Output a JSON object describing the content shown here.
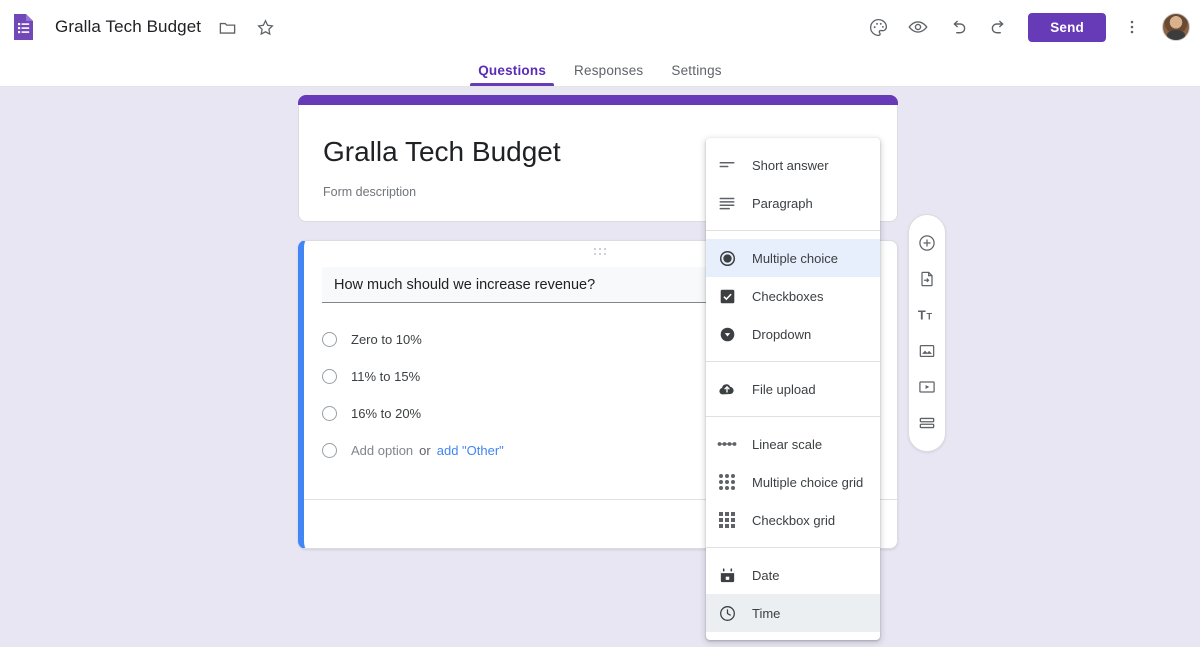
{
  "app": {
    "logo_icon": "google-forms-icon",
    "doc_title": "Gralla Tech Budget",
    "folder_icon": "folder-icon",
    "star_icon": "star-icon"
  },
  "topbar_actions": {
    "theme_icon": "palette-icon",
    "preview_icon": "eye-icon",
    "undo_icon": "undo-icon",
    "redo_icon": "redo-icon",
    "send_label": "Send",
    "more_icon": "more-vert-icon",
    "avatar": "user-avatar"
  },
  "tabs": [
    {
      "label": "Questions",
      "active": true
    },
    {
      "label": "Responses",
      "active": false
    },
    {
      "label": "Settings",
      "active": false
    }
  ],
  "form_header": {
    "title": "Gralla Tech Budget",
    "description_placeholder": "Form description",
    "accent_color": "#673ab7"
  },
  "question": {
    "text": "How much should we increase revenue?",
    "image_icon": "add-image-icon",
    "drag_handle_icon": "drag-handle-icon",
    "duplicate_icon": "duplicate-icon",
    "active_border_color": "#4285f4",
    "options": [
      {
        "label": "Zero to 10%",
        "placeholder": false
      },
      {
        "label": "11% to 15%",
        "placeholder": false
      },
      {
        "label": "16% to 20%",
        "placeholder": false
      }
    ],
    "add_option_label": "Add option",
    "or_label": "or",
    "add_other_label": "add \"Other\""
  },
  "side_toolbar": [
    {
      "name": "add-question-icon",
      "title": "Add question"
    },
    {
      "name": "import-questions-icon",
      "title": "Import questions"
    },
    {
      "name": "add-title-icon",
      "title": "Add title and description"
    },
    {
      "name": "add-image-icon",
      "title": "Add image"
    },
    {
      "name": "add-video-icon",
      "title": "Add video"
    },
    {
      "name": "add-section-icon",
      "title": "Add section"
    }
  ],
  "type_menu": {
    "groups": [
      {
        "items": [
          {
            "label": "Short answer",
            "icon": "short-answer-icon",
            "state": "normal"
          },
          {
            "label": "Paragraph",
            "icon": "paragraph-icon",
            "state": "normal"
          }
        ]
      },
      {
        "items": [
          {
            "label": "Multiple choice",
            "icon": "radio-button-icon",
            "state": "selected"
          },
          {
            "label": "Checkboxes",
            "icon": "checkbox-icon",
            "state": "normal"
          },
          {
            "label": "Dropdown",
            "icon": "dropdown-icon",
            "state": "normal"
          }
        ]
      },
      {
        "items": [
          {
            "label": "File upload",
            "icon": "cloud-upload-icon",
            "state": "normal"
          }
        ]
      },
      {
        "items": [
          {
            "label": "Linear scale",
            "icon": "linear-scale-icon",
            "state": "normal"
          },
          {
            "label": "Multiple choice grid",
            "icon": "radio-grid-icon",
            "state": "normal"
          },
          {
            "label": "Checkbox grid",
            "icon": "checkbox-grid-icon",
            "state": "normal"
          }
        ]
      },
      {
        "items": [
          {
            "label": "Date",
            "icon": "calendar-icon",
            "state": "normal"
          },
          {
            "label": "Time",
            "icon": "clock-icon",
            "state": "hover"
          }
        ]
      }
    ]
  },
  "colors": {
    "background": "#e9e6f3",
    "accent_purple": "#673ab7",
    "active_blue": "#4285f4",
    "link_blue": "#4285f4",
    "menu_selected": "#e7eefc"
  }
}
